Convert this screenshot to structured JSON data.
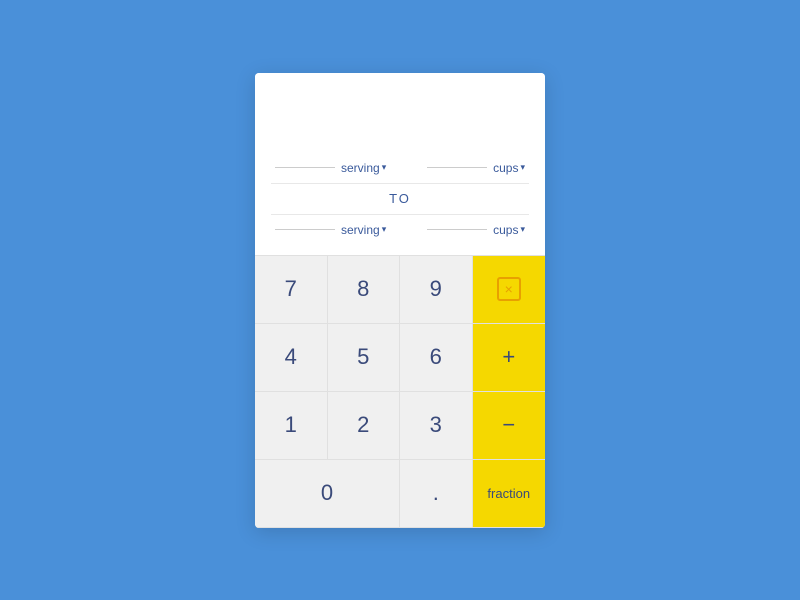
{
  "calculator": {
    "top_row": {
      "input_value": "",
      "from_unit": "serving",
      "to_unit": "cups"
    },
    "divider_label": "TO",
    "bottom_row": {
      "input_value": "",
      "from_unit": "serving",
      "to_unit": "cups"
    },
    "keypad": {
      "rows": [
        [
          "7",
          "8",
          "9",
          "⌫"
        ],
        [
          "4",
          "5",
          "6",
          "+"
        ],
        [
          "1",
          "2",
          "3",
          "−"
        ],
        [
          "0",
          ".",
          "fraction"
        ]
      ],
      "backspace_label": "⌫",
      "plus_label": "+",
      "minus_label": "−",
      "fraction_label": "fraction",
      "dot_label": "."
    }
  }
}
